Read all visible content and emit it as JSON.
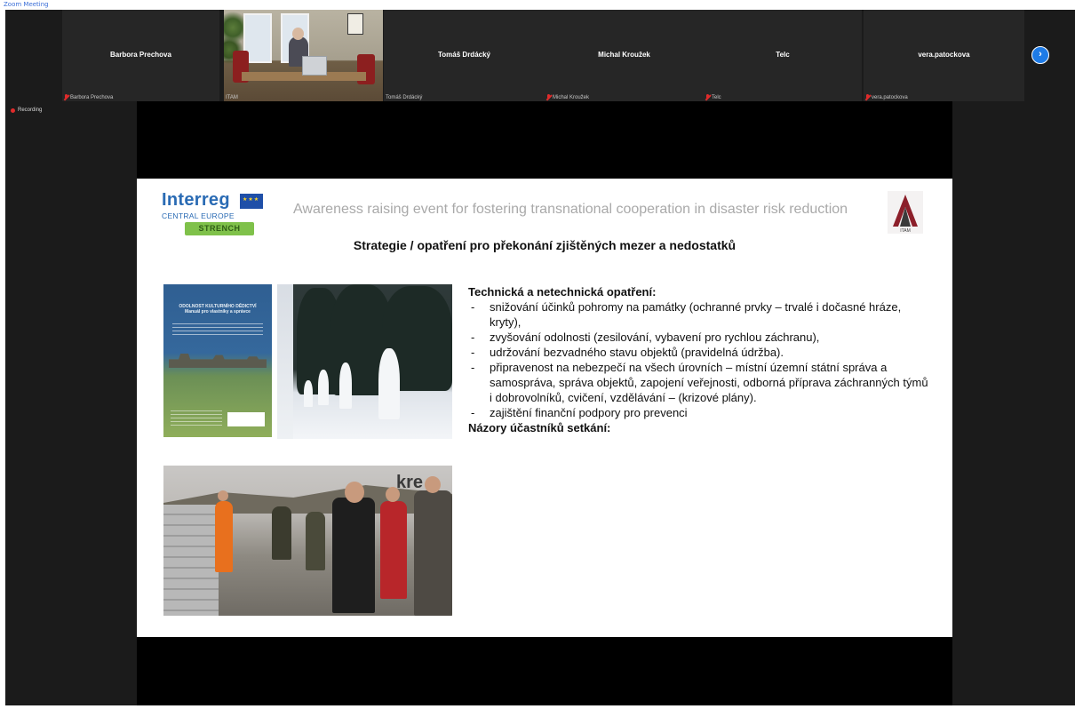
{
  "top_indicator": "Zoom Meeting",
  "participants": [
    {
      "name": "Barbora Prechova",
      "caption": "Barbora Prechova",
      "muted": true,
      "video": false
    },
    {
      "name": "",
      "caption": "ITAM",
      "muted": false,
      "video": true
    },
    {
      "name": "Tomáš Drdácký",
      "caption": "Tomáš Drdácký",
      "muted": false,
      "video": false
    },
    {
      "name": "Michal Kroužek",
      "caption": "Michal Kroužek",
      "muted": true,
      "video": false
    },
    {
      "name": "Telc",
      "caption": "Telc",
      "muted": true,
      "video": false
    },
    {
      "name": "vera.patockova",
      "caption": "vera.patockova",
      "muted": true,
      "video": false
    }
  ],
  "next_page_icon": "chevron-right-icon",
  "recording_label": "Recording",
  "slide": {
    "logo_word": "Interreg",
    "logo_sub": "CENTRAL EUROPE",
    "logo_badge": "STRENCH",
    "logo_caption": "Interreg CENTRAL EUROPE STRENCH",
    "header": "Awareness raising event for fostering transnational cooperation in disaster risk reduction",
    "org_logo": "ITAM",
    "subtitle": "Strategie / opatření pro překonání zjištěných mezer a nedostatků",
    "booklet_title": "ODOLNOST KULTURNÍHO DĚDICTVÍ\nManuál pro vlastníky a správce",
    "images": [
      "booklet-cover",
      "snow-statues-photo",
      "flood-barrier-photo"
    ],
    "heading": "Technická a netechnická opatření:",
    "bullets": [
      "snižování účinků pohromy na památky (ochranné prvky – trvalé i dočasné hráze, kryty),",
      "zvyšování odolnosti (zesilování, vybavení pro rychlou záchranu),",
      "udržování bezvadného stavu objektů (pravidelná údržba).",
      "připravenost na nebezpečí na všech úrovních – místní územní státní správa a samospráva, správa objektů, zapojení veřejnosti, odborná příprava záchranných týmů i dobrovolníků, cvičení, vzdělávání – (krizové plány).",
      "zajištění finanční podpory pro prevenci"
    ],
    "heading2": "Názory účastníků setkání:",
    "photo_sign": "kre"
  },
  "colors": {
    "background": "#1b1b1b",
    "tile": "#262626",
    "accent_blue": "#1e7be6",
    "muted_red": "#e02b2b",
    "slide_bg": "#ffffff",
    "interreg_blue": "#2a6bb4",
    "strench_green": "#7fc14a"
  }
}
